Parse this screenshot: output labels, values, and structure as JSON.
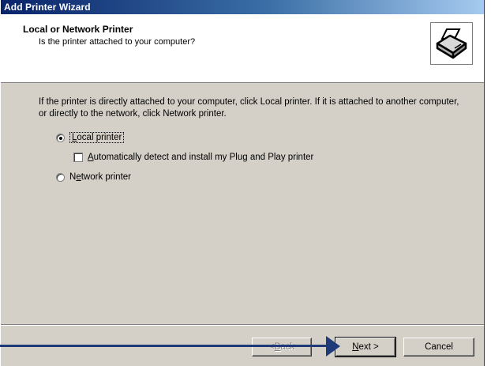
{
  "window": {
    "title": "Add Printer Wizard"
  },
  "header": {
    "title": "Local or Network Printer",
    "subtitle": "Is the printer attached to your computer?",
    "icon": "printer-icon"
  },
  "body": {
    "instructions": "If the printer is directly attached to your computer, click Local printer.  If it is attached to another computer, or directly to the network, click Network printer."
  },
  "options": {
    "local_printer": {
      "accel": "L",
      "rest": "ocal printer",
      "checked": true
    },
    "auto_detect": {
      "accel": "A",
      "rest": "utomatically detect and install my Plug and Play printer",
      "checked": false
    },
    "network_printer": {
      "pre": "N",
      "accel": "e",
      "rest": "twork printer",
      "checked": false
    }
  },
  "buttons": {
    "back": {
      "pre": "< ",
      "accel": "B",
      "rest": "ack",
      "enabled": false
    },
    "next": {
      "accel": "N",
      "rest": "ext >",
      "default": true
    },
    "cancel": "Cancel"
  },
  "colors": {
    "titlebar_start": "#0a246a",
    "titlebar_end": "#a6caf0",
    "dialog_face": "#d4d0c8",
    "annotation_arrow": "#1e3a78"
  }
}
